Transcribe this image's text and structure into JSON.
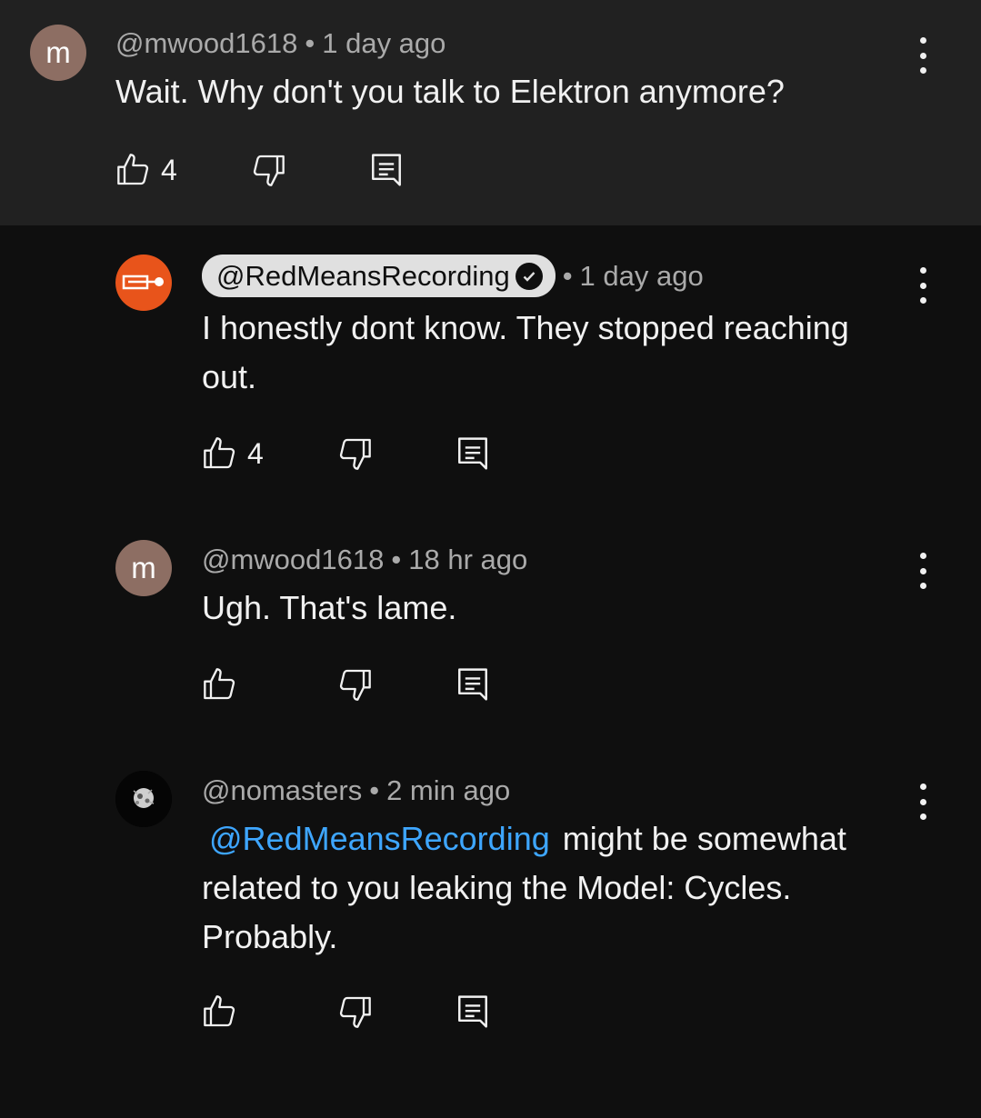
{
  "comments": [
    {
      "author": "@mwood1618",
      "avatar_letter": "m",
      "time": "1 day ago",
      "text": "Wait. Why don't you talk to Elektron anymore?",
      "likes": "4"
    },
    {
      "author": "@RedMeansRecording",
      "verified": true,
      "time": "1 day ago",
      "text_line1": "I honestly dont know. They stopped reaching",
      "text_line2": "out.",
      "likes": "4"
    },
    {
      "author": "@mwood1618",
      "avatar_letter": "m",
      "time": "18 hr ago",
      "text": "Ugh. That's lame.",
      "likes": ""
    },
    {
      "author": "@nomasters",
      "time": "2 min ago",
      "mention": "@RedMeansRecording",
      "text_line1_rest": "might be somewhat",
      "text_line2": "related to you leaking the Model: Cycles.",
      "text_line3": "Probably.",
      "likes": ""
    }
  ],
  "separator": "•",
  "colors": {
    "background": "#0f0f0f",
    "parent_background": "#212121",
    "mention": "#3ea6ff",
    "channel_avatar": "#e8541b",
    "letter_avatar": "#8d6e63"
  },
  "icons": [
    "like-icon",
    "dislike-icon",
    "reply-icon",
    "more-options-icon",
    "verified-check-icon"
  ]
}
